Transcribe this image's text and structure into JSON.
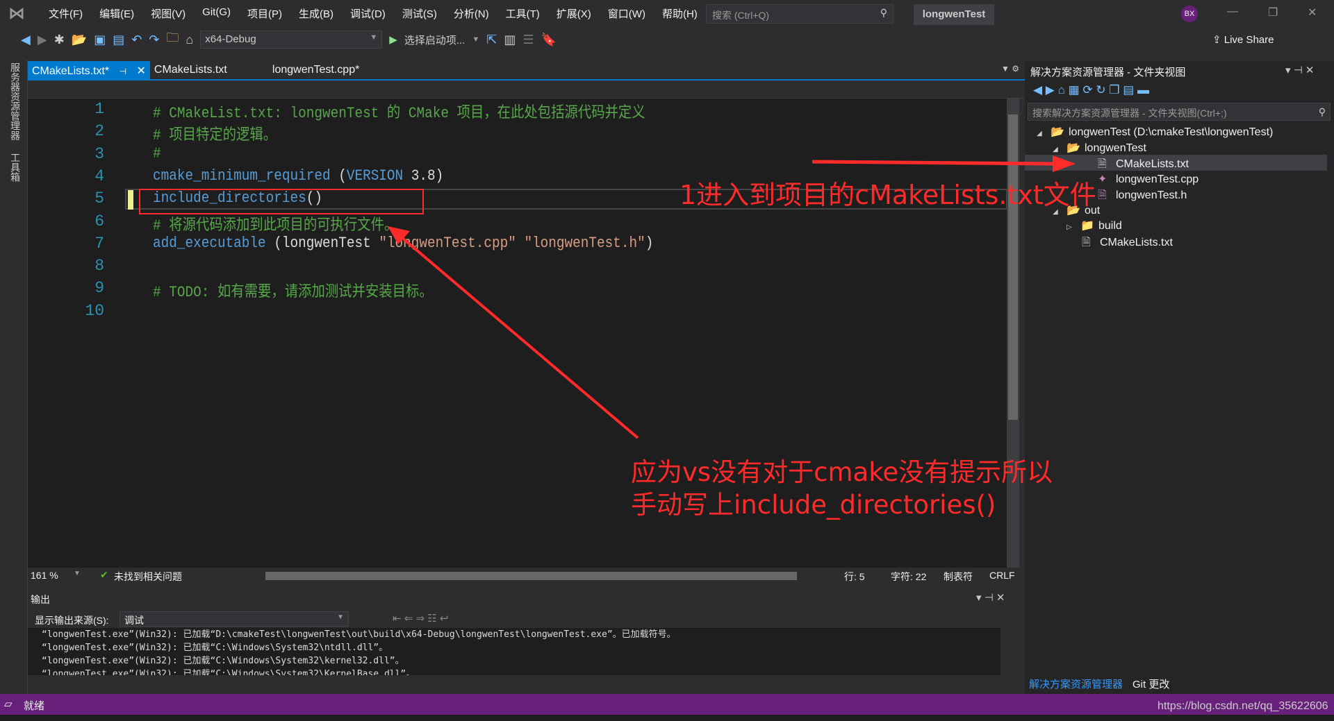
{
  "menubar": {
    "items": [
      "文件(F)",
      "编辑(E)",
      "视图(V)",
      "Git(G)",
      "项目(P)",
      "生成(B)",
      "调试(D)",
      "测试(S)",
      "分析(N)",
      "工具(T)",
      "扩展(X)",
      "窗口(W)",
      "帮助(H)"
    ],
    "search_placeholder": "搜索 (Ctrl+Q)",
    "project_name": "longwenTest",
    "avatar": "BX"
  },
  "toolbar": {
    "config": "x64-Debug",
    "start_item": "选择启动项...",
    "live_share": "Live Share"
  },
  "left_strip": {
    "server_explorer": "服务器资源管理器",
    "toolbox": "工具箱"
  },
  "tabs": [
    {
      "label": "CMakeLists.txt*",
      "active": true
    },
    {
      "label": "CMakeLists.txt"
    },
    {
      "label": "longwenTest.cpp*"
    }
  ],
  "editor": {
    "lines": [
      [
        {
          "t": "# CMakeList.txt: longwenTest 的 CMake 项目，在此处包括源代码并定义",
          "c": "cm"
        }
      ],
      [
        {
          "t": "# 项目特定的逻辑。",
          "c": "cm"
        }
      ],
      [
        {
          "t": "#",
          "c": "cm"
        }
      ],
      [
        {
          "t": "cmake_minimum_required",
          "c": "kw"
        },
        {
          "t": " (",
          "c": "tx"
        },
        {
          "t": "VERSION",
          "c": "kw"
        },
        {
          "t": " 3.8)",
          "c": "tx"
        }
      ],
      [
        {
          "t": "include_directories",
          "c": "kw"
        },
        {
          "t": "()",
          "c": "tx"
        }
      ],
      [
        {
          "t": "# 将源代码添加到此项目的可执行文件。",
          "c": "cm"
        }
      ],
      [
        {
          "t": "add_executable",
          "c": "kw"
        },
        {
          "t": " (longwenTest ",
          "c": "tx"
        },
        {
          "t": "\"longwenTest.cpp\" \"longwenTest.h\"",
          "c": "st"
        },
        {
          "t": ")",
          "c": "tx"
        }
      ],
      [],
      [
        {
          "t": "# TODO: 如有需要，请添加测试并安装目标。",
          "c": "cm"
        }
      ],
      []
    ],
    "zoom": "161 %",
    "issues": "未找到相关问题",
    "line": "行: 5",
    "char": "字符: 22",
    "tabs_mode": "制表符",
    "eol": "CRLF"
  },
  "output": {
    "title": "输出",
    "source_label": "显示输出来源(S):",
    "source_value": "调试",
    "lines": [
      "“longwenTest.exe”(Win32): 已加载“D:\\cmakeTest\\longwenTest\\out\\build\\x64-Debug\\longwenTest\\longwenTest.exe”。已加载符号。",
      "“longwenTest.exe”(Win32): 已加载“C:\\Windows\\System32\\ntdll.dll”。",
      "“longwenTest.exe”(Win32): 已加载“C:\\Windows\\System32\\kernel32.dll”。",
      "“longwenTest.exe”(Win32): 已加载“C:\\Windows\\System32\\KernelBase.dll”。"
    ]
  },
  "solution_explorer": {
    "title": "解决方案资源管理器 - 文件夹视图",
    "search_placeholder": "搜索解决方案资源管理器 - 文件夹视图(Ctrl+;)",
    "tree": [
      "longwenTest (D:\\cmakeTest\\longwenTest)",
      "longwenTest",
      "CMakeLists.txt",
      "longwenTest.cpp",
      "longwenTest.h",
      "out",
      "build",
      "CMakeLists.txt"
    ],
    "bottom_tabs": [
      "解决方案资源管理器",
      "Git 更改"
    ]
  },
  "statusbar": {
    "text": "就绪",
    "watermark": "https://blog.csdn.net/qq_35622606"
  },
  "annotations": {
    "note1": "1进入到项目的cMakeLists.txt文件",
    "note2_line1": "应为vs没有对于cmake没有提示所以",
    "note2_line2": "手动写上include_directories()",
    "color": "#ff2a2a"
  }
}
